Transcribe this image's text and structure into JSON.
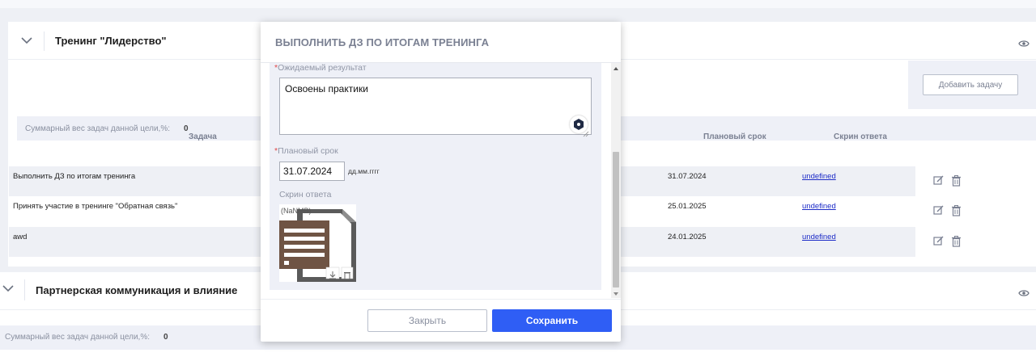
{
  "goal1": {
    "title": "Тренинг \"Лидерство\""
  },
  "add_task_button": "Добавить задачу",
  "weight": {
    "label": "Суммарный вес задач данной цели,%:",
    "value": "0"
  },
  "table": {
    "headers": {
      "task": "Задача",
      "deadline": "Плановый срок",
      "screen": "Скрин ответа"
    },
    "rows": [
      {
        "task": "Выполнить ДЗ по итогам тренинга",
        "deadline": "31.07.2024",
        "screen": "undefined"
      },
      {
        "task": "Принять участие в тренинге \"Обратная связь\"",
        "deadline": "25.01.2025",
        "screen": "undefined"
      },
      {
        "task": "awd",
        "deadline": "24.01.2025",
        "screen": "undefined"
      }
    ]
  },
  "goal2": {
    "title": "Партнерская коммуникация и влияние",
    "weight_label": "Суммарный вес задач данной цели,%:",
    "weight_value": "0"
  },
  "modal": {
    "title": "ВЫПОЛНИТЬ ДЗ ПО ИТОГАМ ТРЕНИНГА",
    "result_label": "Ожидаемый результат",
    "result_value": "Освоены практики",
    "deadline_label": "Плановый срок",
    "deadline_value": "31.07.2024",
    "date_format_hint": "дд.мм.гггг",
    "screen_label": "Скрин ответа",
    "file_size": "(NaNMB)",
    "close_button": "Закрыть",
    "save_button": "Сохранить"
  },
  "colors": {
    "primary": "#2f5ef5",
    "link": "#1c2bc7",
    "required": "#e04848",
    "panel": "#eef0f7"
  },
  "icons": [
    "chevron-down-icon",
    "eye-icon",
    "edit-icon",
    "trash-icon",
    "document-icon",
    "download-icon",
    "delete-icon"
  ]
}
